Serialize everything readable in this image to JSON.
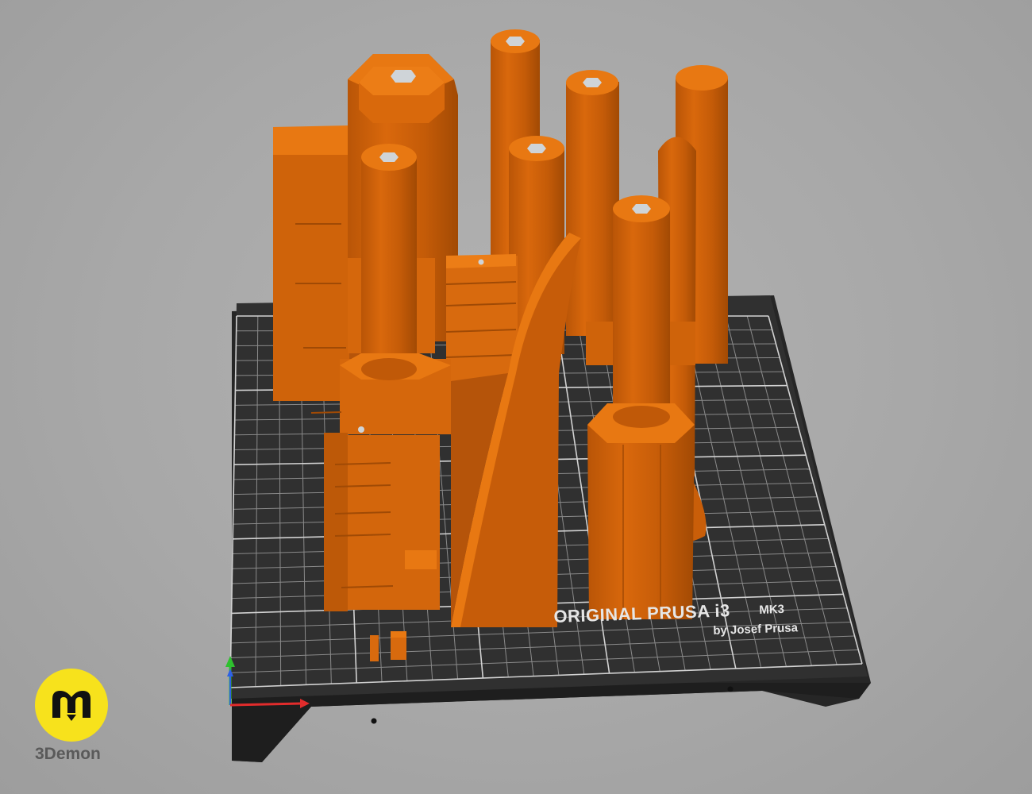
{
  "bed": {
    "brand": "ORIGINAL PRUSA i3",
    "model": "MK3",
    "author": "by Josef Prusa"
  },
  "watermark": {
    "name": "3Demon"
  },
  "colors": {
    "background": "#a8a8a8",
    "bed": "#2b2b2b",
    "grid": "#cfcfcf",
    "part_light": "#e6720f",
    "part_mid": "#c85e0a",
    "part_dark": "#a44b05",
    "logo_yellow": "#f7e21c"
  },
  "icons": {
    "axis_gizmo": "xyz-axes-icon",
    "logo": "3demon-logo-icon"
  }
}
